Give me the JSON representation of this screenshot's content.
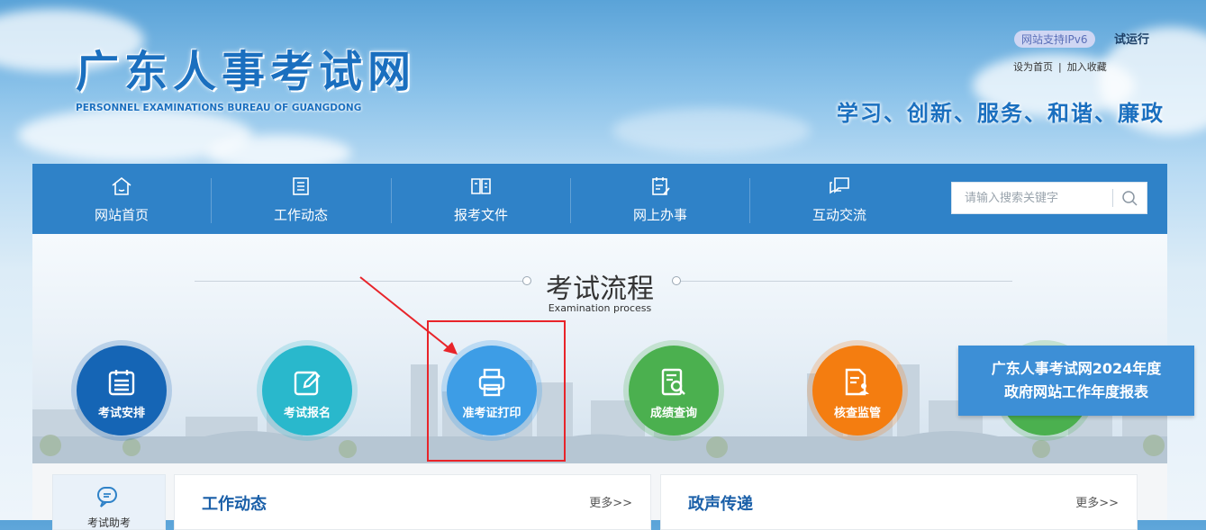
{
  "header": {
    "logo_cn": "广东人事考试网",
    "logo_en": "PERSONNEL EXAMINATIONS BUREAU OF GUANGDONG",
    "ipv6_badge": "网站支持IPv6",
    "trial_label": "试运行",
    "set_home": "设为首页",
    "link_sep": "|",
    "add_favorite": "加入收藏",
    "slogan": "学习、创新、服务、和谐、廉政"
  },
  "nav": {
    "items": [
      {
        "label": "网站首页",
        "icon": "home-icon"
      },
      {
        "label": "工作动态",
        "icon": "list-icon"
      },
      {
        "label": "报考文件",
        "icon": "book-icon"
      },
      {
        "label": "网上办事",
        "icon": "clipboard-icon"
      },
      {
        "label": "互动交流",
        "icon": "chat-icon"
      }
    ],
    "search_placeholder": "请输入搜索关键字"
  },
  "process": {
    "title": "考试流程",
    "subtitle": "Examination process",
    "steps": [
      {
        "label": "考试安排",
        "color": "#1565b5"
      },
      {
        "label": "考试报名",
        "color": "#29b8cc"
      },
      {
        "label": "准考证打印",
        "color": "#3d9de6"
      },
      {
        "label": "成绩查询",
        "color": "#4bb04f"
      },
      {
        "label": "核查监管",
        "color": "#f47d10"
      }
    ],
    "report_line1": "广东人事考试网2024年度",
    "report_line2": "政府网站工作年度报表"
  },
  "bottom": {
    "side_card_label": "考试助考",
    "panels": [
      {
        "title": "工作动态",
        "more": "更多>>"
      },
      {
        "title": "政声传递",
        "more": "更多>>"
      }
    ]
  },
  "colors": {
    "nav_bg": "#2f82c8",
    "accent": "#1a6fbf",
    "highlight_box": "#e8242a"
  }
}
